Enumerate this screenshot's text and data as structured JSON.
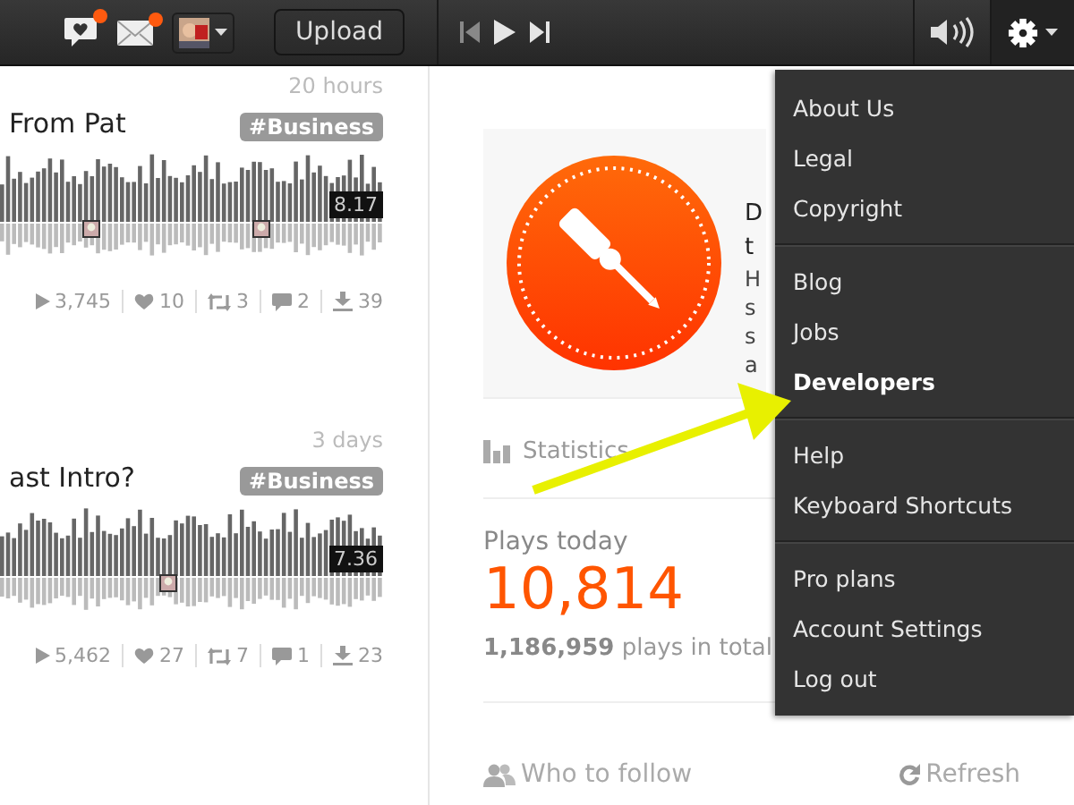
{
  "top_bar": {
    "activity_unread": true,
    "messages_unread": true,
    "upload_label": "Upload"
  },
  "tracks": [
    {
      "title": "From Pat",
      "time": "20 hours",
      "tag": "#Business",
      "duration": "8.17",
      "plays": "3,745",
      "likes": "10",
      "reposts": "3",
      "comments": "2",
      "downloads": "39"
    },
    {
      "title": "ast Intro?",
      "time": "3 days",
      "tag": "#Business",
      "duration": "7.36",
      "plays": "5,462",
      "likes": "27",
      "reposts": "7",
      "comments": "1",
      "downloads": "23"
    }
  ],
  "promo": {
    "title_lines": [
      "D",
      "t"
    ],
    "text_lines": [
      "H",
      "s",
      "s",
      "a"
    ]
  },
  "statistics": {
    "heading": "Statistics",
    "plays_label": "Plays today",
    "plays_today": "10,814",
    "total_number": "1,186,959",
    "total_suffix": "plays in total"
  },
  "who_to_follow": {
    "heading": "Who to follow",
    "refresh": "Refresh"
  },
  "menu": {
    "groups": [
      [
        {
          "label": "About Us",
          "selected": false
        },
        {
          "label": "Legal",
          "selected": false
        },
        {
          "label": "Copyright",
          "selected": false
        }
      ],
      [
        {
          "label": "Blog",
          "selected": false
        },
        {
          "label": "Jobs",
          "selected": false
        },
        {
          "label": "Developers",
          "selected": true
        }
      ],
      [
        {
          "label": "Help",
          "selected": false
        },
        {
          "label": "Keyboard Shortcuts",
          "selected": false
        }
      ],
      [
        {
          "label": "Pro plans",
          "selected": false
        },
        {
          "label": "Account Settings",
          "selected": false
        },
        {
          "label": "Log out",
          "selected": false
        }
      ]
    ]
  },
  "annotation": {
    "kind": "arrow"
  }
}
